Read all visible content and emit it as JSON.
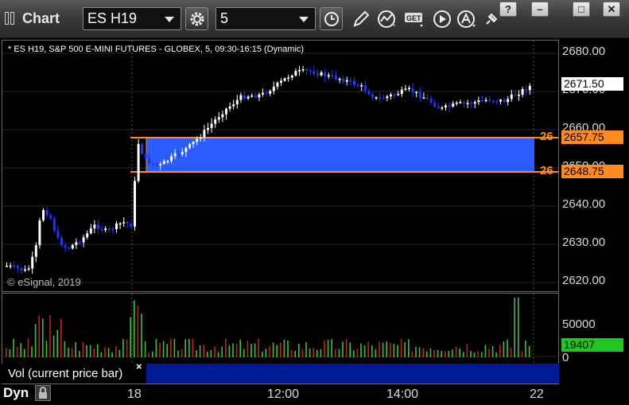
{
  "window": {
    "title": "Chart",
    "help_label": "?",
    "minimize_label": "–",
    "maximize_label": "□",
    "close_label": "✕"
  },
  "toolbar": {
    "symbol_value": "ES H19",
    "interval_value": "5",
    "icons": [
      "settings-gear-icon",
      "clock-icon",
      "pencil-draw-icon",
      "indicator-icon",
      "get-icon",
      "play-icon",
      "alert-icon",
      "pin-icon"
    ]
  },
  "chart": {
    "header": "* ES H19, S&P 500 E-MINI FUTURES - GLOBEX, 5, 09:30-16:15 (Dynamic)",
    "copyright": "© eSignal, 2019",
    "price_ticks": [
      "2680.00",
      "2670.00",
      "2660.00",
      "2650.00",
      "2640.00",
      "2630.00",
      "2620.00"
    ],
    "last_price": "2671.50",
    "zone_upper_prefix": "26",
    "zone_upper_price": "2657.75",
    "zone_lower_prefix": "26",
    "zone_lower_price": "2648.75",
    "colors": {
      "up": "#ffffff",
      "down": "#2233ff",
      "zone": "#2a5cff",
      "zone_border": "#ff8a1f"
    }
  },
  "volume": {
    "label": "Vol (current price bar)",
    "close_label": "×",
    "ticks": [
      "50000",
      "0"
    ],
    "current": "19407"
  },
  "time_axis": {
    "mode_label": "Dyn",
    "labels": [
      "18",
      "12:00",
      "14:00",
      "22"
    ]
  }
}
